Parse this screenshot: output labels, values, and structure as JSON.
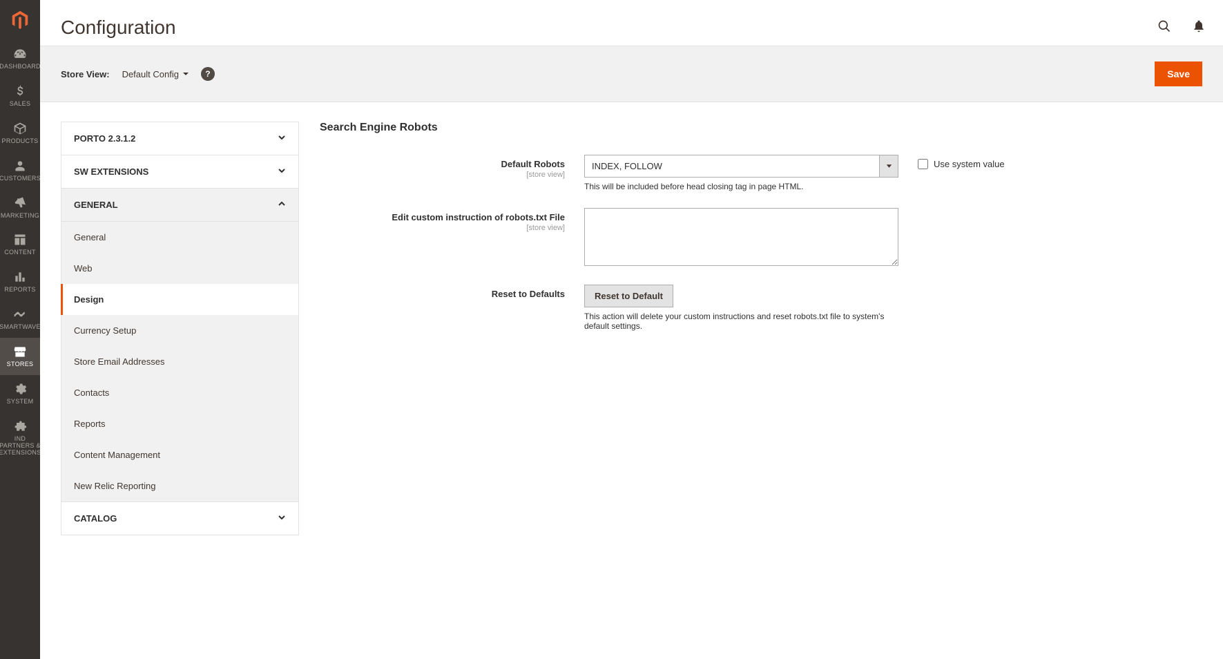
{
  "page": {
    "title": "Configuration"
  },
  "scope": {
    "label": "Store View:",
    "value": "Default Config",
    "save": "Save"
  },
  "adminNav": {
    "dashboard": "DASHBOARD",
    "sales": "SALES",
    "products": "PRODUCTS",
    "customers": "CUSTOMERS",
    "marketing": "MARKETING",
    "content": "CONTENT",
    "reports": "REPORTS",
    "smartwave": "SMARTWAVE",
    "stores": "STORES",
    "system": "SYSTEM",
    "partners": "IND PARTNERS & EXTENSIONS"
  },
  "tabs": {
    "porto": "PORTO 2.3.1.2",
    "sw": "SW EXTENSIONS",
    "general": "GENERAL",
    "generalItems": {
      "general": "General",
      "web": "Web",
      "design": "Design",
      "currency": "Currency Setup",
      "storeEmail": "Store Email Addresses",
      "contacts": "Contacts",
      "reports": "Reports",
      "contentMgmt": "Content Management",
      "newRelic": "New Relic Reporting"
    },
    "catalog": "CATALOG"
  },
  "section": {
    "title": "Search Engine Robots"
  },
  "fields": {
    "defaultRobots": {
      "label": "Default Robots",
      "scope": "[store view]",
      "value": "INDEX, FOLLOW",
      "note": "This will be included before head closing tag in page HTML.",
      "useSystem": "Use system value"
    },
    "customRobots": {
      "label": "Edit custom instruction of robots.txt File",
      "scope": "[store view]",
      "value": ""
    },
    "reset": {
      "label": "Reset to Defaults",
      "button": "Reset to Default",
      "note": "This action will delete your custom instructions and reset robots.txt file to system's default settings."
    }
  }
}
